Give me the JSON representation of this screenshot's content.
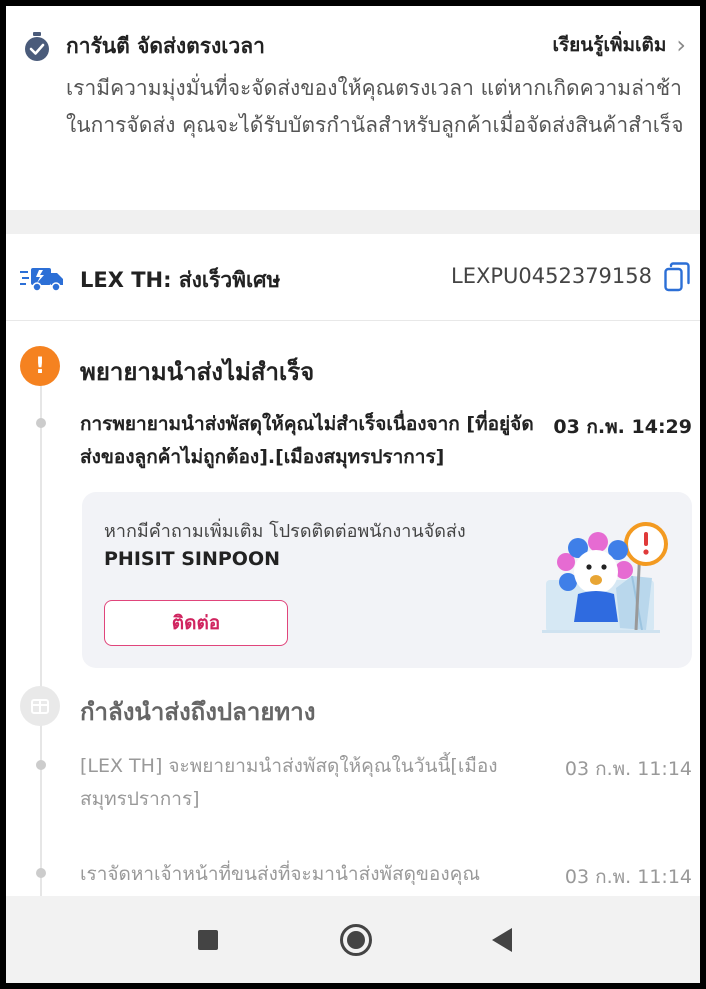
{
  "guarantee": {
    "title": "การันตี จัดส่งตรงเวลา",
    "learn_more": "เรียนรู้เพิ่มเติม",
    "description": "เรามีความมุ่งมั่นที่จะจัดส่งของให้คุณตรงเวลา แต่หากเกิดความล่าช้าในการจัดส่ง คุณจะได้รับบัตรกำนัลสำหรับลูกค้าเมื่อจัดส่งสินค้าสำเร็จ"
  },
  "carrier": {
    "name": "LEX TH: ส่งเร็วพิเศษ",
    "tracking_number": "LEXPU0452379158"
  },
  "timeline": {
    "status_failed": {
      "title": "พยายามนำส่งไม่สำเร็จ",
      "event": {
        "text": "การพยายามนำส่งพัสดุให้คุณไม่สำเร็จเนื่องจาก [ที่อยู่จัดส่งของลูกค้าไม่ถูกต้อง].[เมืองสมุทรปราการ]",
        "time": "03 ก.พ. 14:29"
      },
      "contact_card": {
        "question": "หากมีคำถามเพิ่มเติม โปรดติดต่อพนักงานจัดส่ง",
        "courier_name": "PHISIT SINPOON",
        "button_label": "ติดต่อ"
      }
    },
    "status_transit": {
      "title": "กำลังนำส่งถึงปลายทาง",
      "events": [
        {
          "text": "[LEX TH] จะพยายามนำส่งพัสดุให้คุณในวันนี้[เมืองสมุทรปราการ]",
          "time": "03 ก.พ. 11:14"
        },
        {
          "text": "เราจัดหาเจ้าหน้าที่ขนส่งที่จะมานำส่งพัสดุของคุณ",
          "time": "03 ก.พ. 11:14"
        }
      ]
    }
  },
  "colors": {
    "warning": "#f58220",
    "accent": "#d0245f",
    "truck": "#2c6fd6"
  }
}
